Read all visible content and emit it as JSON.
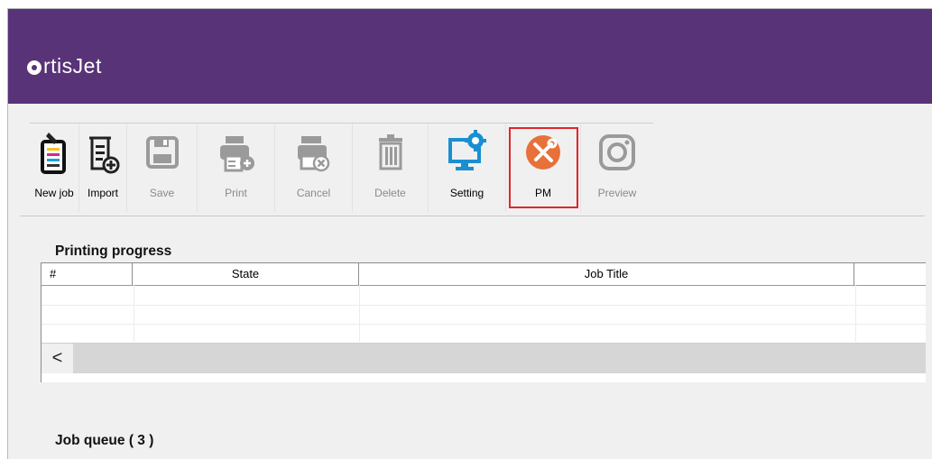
{
  "brand": {
    "name": "rtisJet"
  },
  "toolbar": {
    "items": [
      {
        "label": "New job",
        "icon": "new-job-icon",
        "enabled": true
      },
      {
        "label": "Import",
        "icon": "import-icon",
        "enabled": true
      },
      {
        "label": "Save",
        "icon": "save-icon",
        "enabled": false
      },
      {
        "label": "Print",
        "icon": "print-icon",
        "enabled": false
      },
      {
        "label": "Cancel",
        "icon": "cancel-print-icon",
        "enabled": false
      },
      {
        "label": "Delete",
        "icon": "trash-icon",
        "enabled": false
      },
      {
        "label": "Setting",
        "icon": "monitor-gear-icon",
        "enabled": true
      },
      {
        "label": "PM",
        "icon": "tools-icon",
        "enabled": true,
        "selected": true
      },
      {
        "label": "Preview",
        "icon": "camera-icon",
        "enabled": false
      }
    ]
  },
  "printing_progress": {
    "title": "Printing progress",
    "columns": [
      "#",
      "State",
      "Job Title"
    ],
    "rows": [],
    "scroll_left": "<"
  },
  "job_queue": {
    "title": "Job queue ( 3 )"
  },
  "colors": {
    "brand_purple": "#583377",
    "pm_orange": "#e8703a",
    "setting_blue": "#1a8fd0",
    "selection_red": "#e0262a",
    "disabled_gray": "#9a9a9a"
  }
}
